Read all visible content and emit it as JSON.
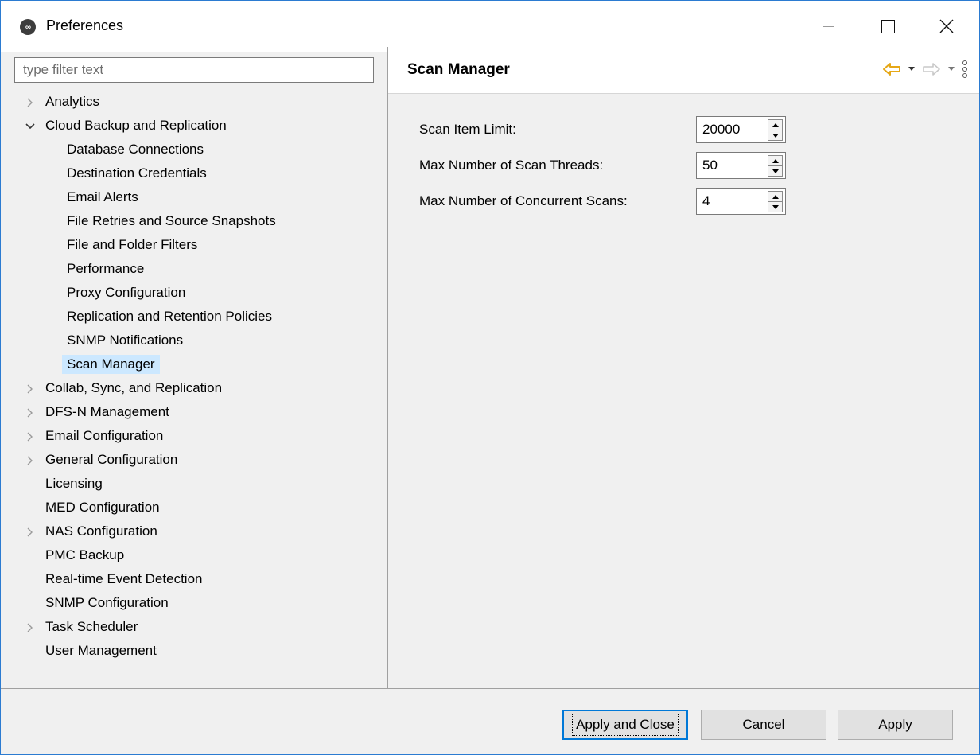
{
  "window": {
    "title": "Preferences",
    "app_icon": "peer-logo-icon"
  },
  "filter": {
    "placeholder": "type filter text"
  },
  "tree": {
    "items": [
      {
        "label": "Analytics",
        "level": 0,
        "expander": "collapsed"
      },
      {
        "label": "Cloud Backup and Replication",
        "level": 0,
        "expander": "expanded"
      },
      {
        "label": "Database Connections",
        "level": 1,
        "expander": "none"
      },
      {
        "label": "Destination Credentials",
        "level": 1,
        "expander": "none"
      },
      {
        "label": "Email Alerts",
        "level": 1,
        "expander": "none"
      },
      {
        "label": "File Retries and Source Snapshots",
        "level": 1,
        "expander": "none"
      },
      {
        "label": "File and Folder Filters",
        "level": 1,
        "expander": "none"
      },
      {
        "label": "Performance",
        "level": 1,
        "expander": "none"
      },
      {
        "label": "Proxy Configuration",
        "level": 1,
        "expander": "none"
      },
      {
        "label": "Replication and Retention Policies",
        "level": 1,
        "expander": "none"
      },
      {
        "label": "SNMP Notifications",
        "level": 1,
        "expander": "none"
      },
      {
        "label": "Scan Manager",
        "level": 1,
        "expander": "none",
        "selected": true
      },
      {
        "label": "Collab, Sync, and Replication",
        "level": 0,
        "expander": "collapsed"
      },
      {
        "label": "DFS-N Management",
        "level": 0,
        "expander": "collapsed"
      },
      {
        "label": "Email Configuration",
        "level": 0,
        "expander": "collapsed"
      },
      {
        "label": "General Configuration",
        "level": 0,
        "expander": "collapsed"
      },
      {
        "label": "Licensing",
        "level": 0,
        "expander": "none"
      },
      {
        "label": "MED Configuration",
        "level": 0,
        "expander": "none"
      },
      {
        "label": "NAS Configuration",
        "level": 0,
        "expander": "collapsed"
      },
      {
        "label": "PMC Backup",
        "level": 0,
        "expander": "none"
      },
      {
        "label": "Real-time Event Detection",
        "level": 0,
        "expander": "none"
      },
      {
        "label": "SNMP Configuration",
        "level": 0,
        "expander": "none"
      },
      {
        "label": "Task Scheduler",
        "level": 0,
        "expander": "collapsed"
      },
      {
        "label": "User Management",
        "level": 0,
        "expander": "none"
      }
    ]
  },
  "page": {
    "title": "Scan Manager",
    "fields": [
      {
        "label": "Scan Item Limit:",
        "value": "20000"
      },
      {
        "label": "Max Number of Scan Threads:",
        "value": "50"
      },
      {
        "label": "Max Number of Concurrent Scans:",
        "value": "4"
      }
    ]
  },
  "buttons": {
    "apply_close": "Apply and Close",
    "cancel": "Cancel",
    "apply": "Apply"
  },
  "colors": {
    "selection": "#cce8ff",
    "accent": "#0078d7",
    "back_arrow": "#e6a817"
  }
}
